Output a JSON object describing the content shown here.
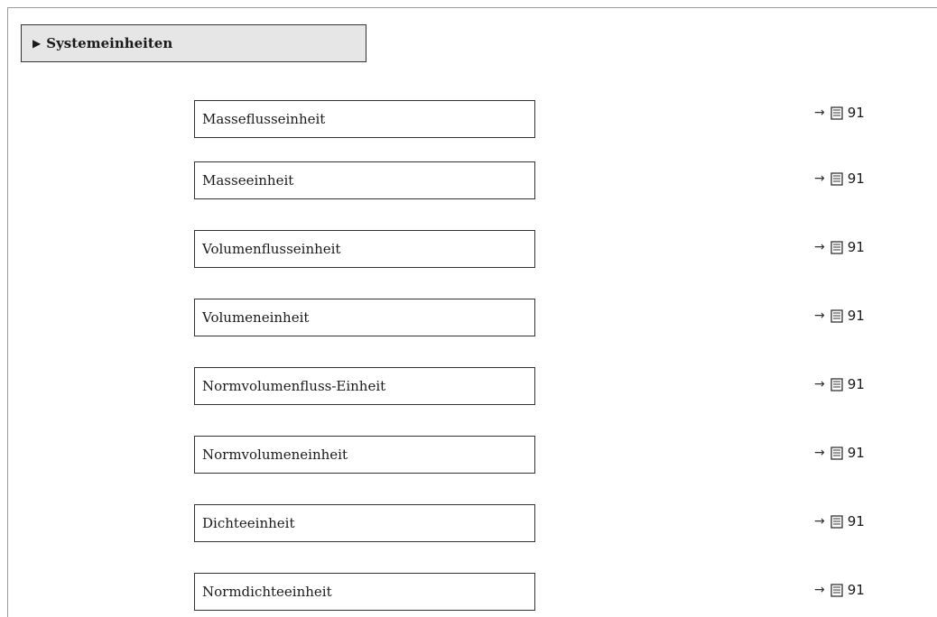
{
  "section": {
    "title": "Systemeinheiten",
    "marker": "▶"
  },
  "items": [
    {
      "label": "Masseflusseinheit",
      "page": "91"
    },
    {
      "label": "Masseeinheit",
      "page": "91"
    },
    {
      "label": "Volumenflusseinheit",
      "page": "91"
    },
    {
      "label": "Volumeneinheit",
      "page": "91"
    },
    {
      "label": "Normvolumenfluss-Einheit",
      "page": "91"
    },
    {
      "label": "Normvolumeneinheit",
      "page": "91"
    },
    {
      "label": "Dichteeinheit",
      "page": "91"
    },
    {
      "label": "Normdichteeinheit",
      "page": "91"
    }
  ],
  "reference_arrow": "→",
  "icons": {
    "page_reference": "book-icon"
  }
}
